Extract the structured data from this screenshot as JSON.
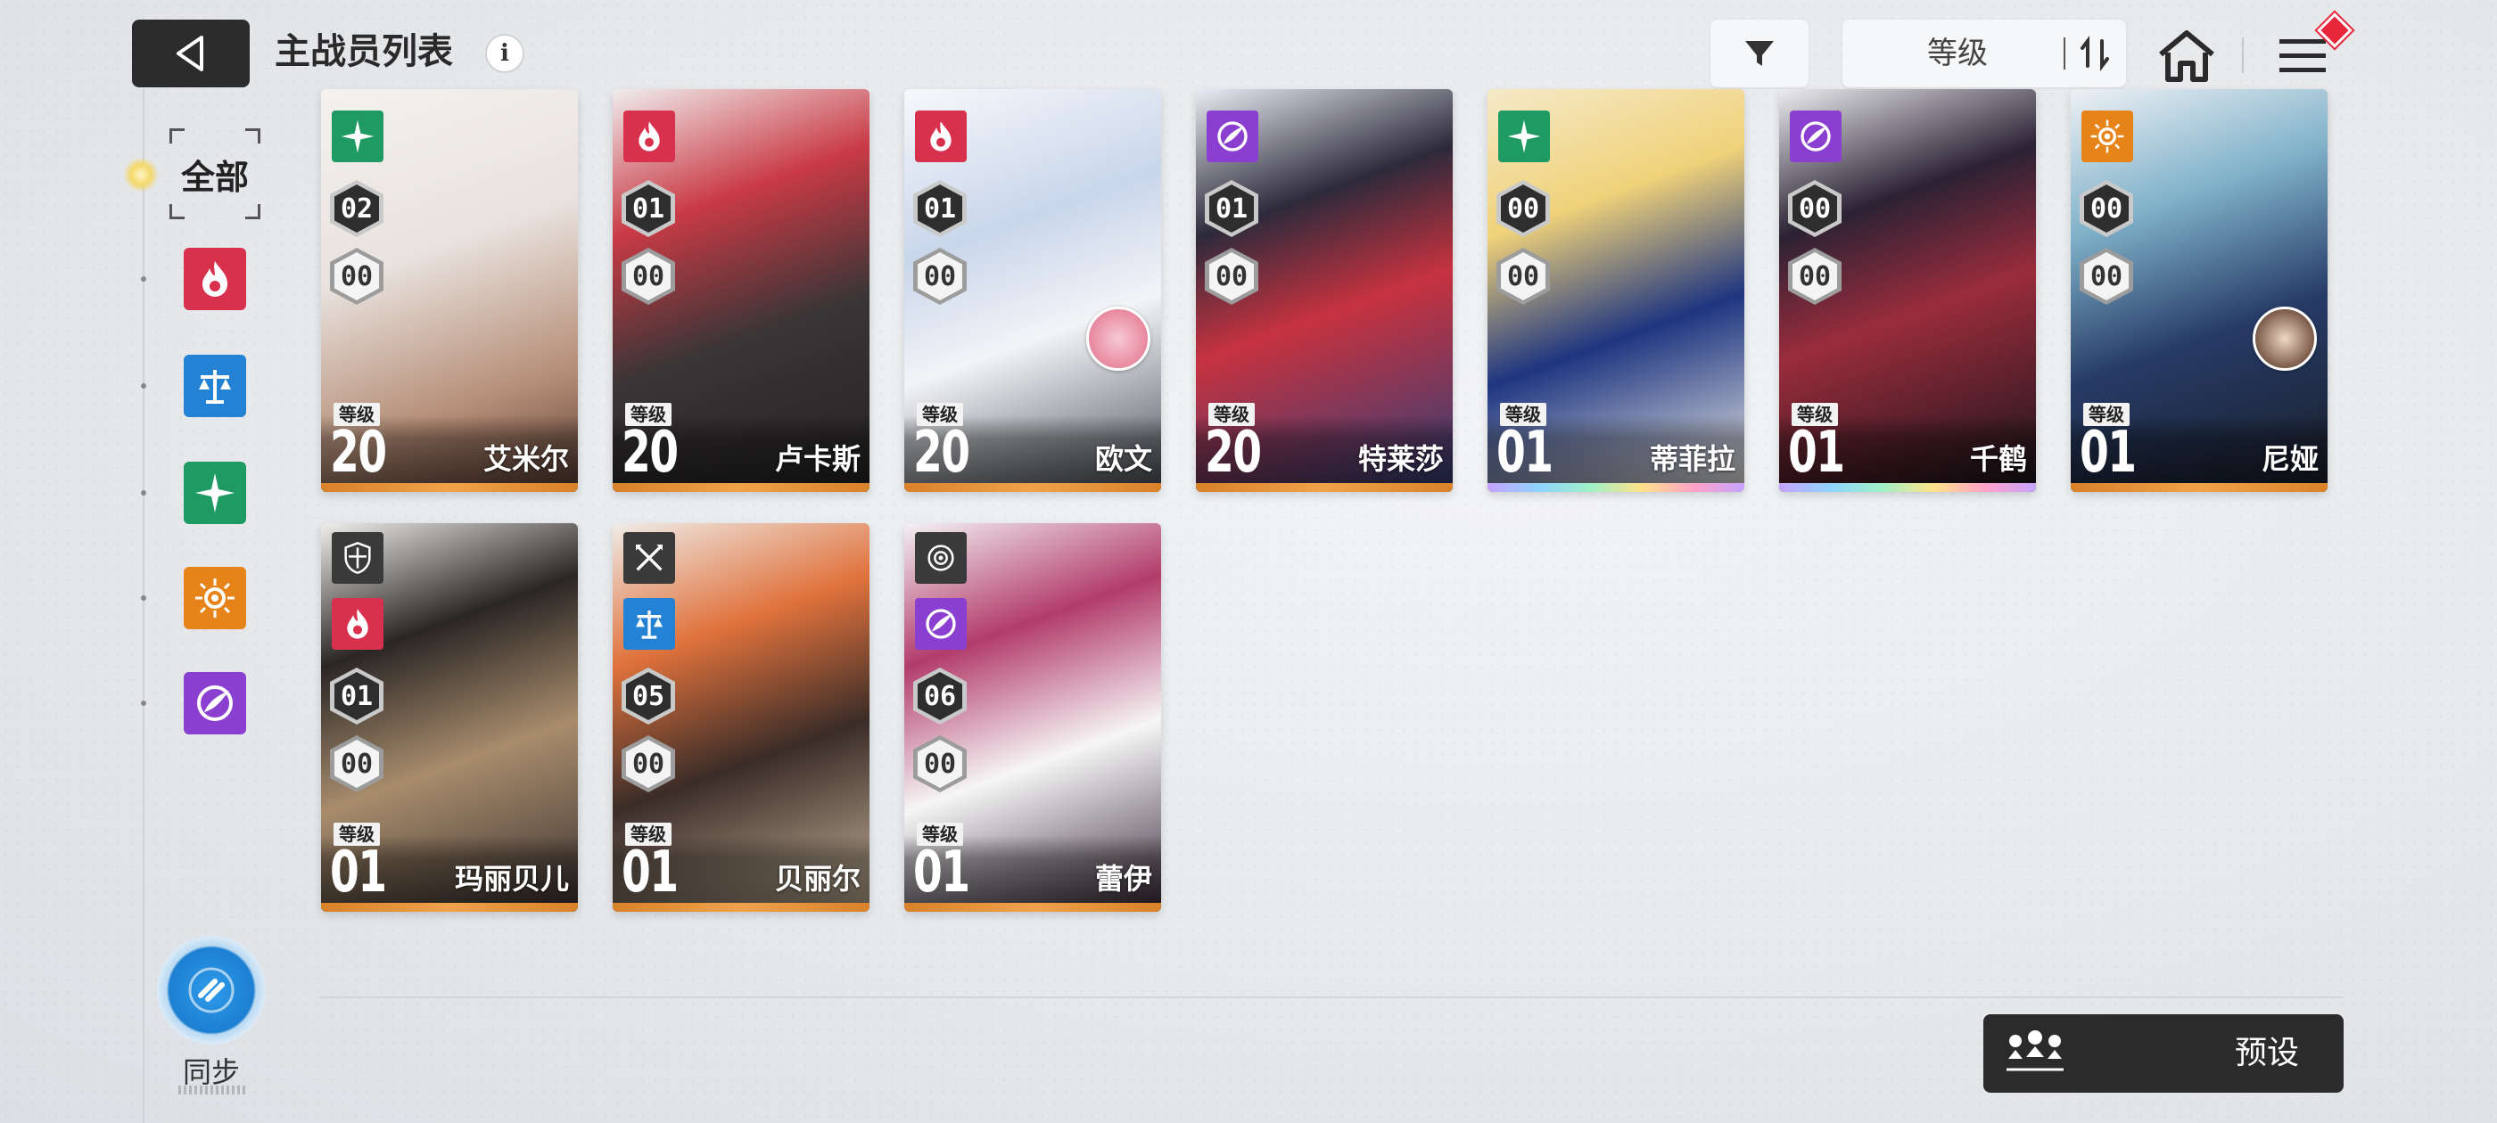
{
  "header": {
    "back_label": "back",
    "title": "主战员列表",
    "info_label": "i",
    "sort_label": "等级"
  },
  "sidebar": {
    "all_label": "全部",
    "filters": [
      {
        "icon": "fire-element-icon",
        "color": "#d8314d"
      },
      {
        "icon": "balance-scale-element-icon",
        "color": "#2382d4"
      },
      {
        "icon": "wind-cross-element-icon",
        "color": "#1f9a63"
      },
      {
        "icon": "sun-element-icon",
        "color": "#e6841a"
      },
      {
        "icon": "void-swirl-element-icon",
        "color": "#8a3fd1"
      }
    ],
    "sync_label": "同步"
  },
  "level_tag": "等级",
  "operators": [
    {
      "name": "艾米尔",
      "level": "20",
      "rank": "02",
      "enhance": "00",
      "element": "wind",
      "frame": "gold"
    },
    {
      "name": "卢卡斯",
      "level": "20",
      "rank": "01",
      "enhance": "00",
      "element": "fire",
      "frame": "gold"
    },
    {
      "name": "欧文",
      "level": "20",
      "rank": "01",
      "enhance": "00",
      "element": "fire",
      "frame": "gold",
      "companion": true
    },
    {
      "name": "特莱莎",
      "level": "20",
      "rank": "01",
      "enhance": "00",
      "element": "void",
      "frame": "gold"
    },
    {
      "name": "蒂菲拉",
      "level": "01",
      "rank": "00",
      "enhance": "00",
      "element": "wind",
      "frame": "rainbow"
    },
    {
      "name": "千鹤",
      "level": "01",
      "rank": "00",
      "enhance": "00",
      "element": "void",
      "frame": "rainbow"
    },
    {
      "name": "尼娅",
      "level": "01",
      "rank": "00",
      "enhance": "00",
      "element": "sun",
      "frame": "gold",
      "companion": true
    },
    {
      "name": "玛丽贝儿",
      "level": "01",
      "rank": "01",
      "enhance": "00",
      "element": "fire",
      "role": "shield",
      "frame": "gold"
    },
    {
      "name": "贝丽尔",
      "level": "01",
      "rank": "05",
      "enhance": "00",
      "element": "balance",
      "role": "blades",
      "frame": "gold"
    },
    {
      "name": "蕾伊",
      "level": "01",
      "rank": "06",
      "enhance": "00",
      "element": "void",
      "role": "target",
      "frame": "gold"
    }
  ],
  "footer": {
    "preset_label": "预设"
  }
}
